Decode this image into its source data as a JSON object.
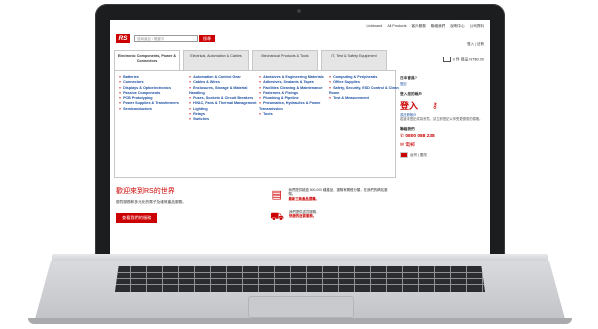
{
  "topbar": [
    "Linkbrand",
    "All Products",
    "客戶服務",
    "聯絡我們",
    "說明中心",
    "公司資料"
  ],
  "login_link": "登入 | 註冊",
  "logo": "RS",
  "search": {
    "placeholder": "搜尋產品 / 關鍵字",
    "button": "搜尋"
  },
  "cart": "0 件 商品 NT$0.00",
  "tabs": [
    {
      "label": "Electronic Components, Power & Connectors",
      "active": true
    },
    {
      "label": "Electrical, Automation & Cables",
      "active": false
    },
    {
      "label": "Mechanical Products & Tools",
      "active": false
    },
    {
      "label": "IT, Test & Safety Equipment",
      "active": false
    }
  ],
  "nav_columns": [
    [
      "Batteries",
      "Connectors",
      "Displays & Optoelectronics",
      "Passive Components",
      "PCB Prototyping",
      "Power Supplies & Transformers",
      "Semiconductors"
    ],
    [
      "Automation & Control Gear",
      "Cables & Wires",
      "Enclosures, Storage & Material Handling",
      "Fuses, Sockets & Circuit Breakers",
      "HVAC, Fans & Thermal Management",
      "Lighting",
      "Relays",
      "Switches"
    ],
    [
      "Abrasives & Engineering Materials",
      "Adhesives, Sealants & Tapes",
      "Facilities Cleaning & Maintenance",
      "Fasteners & Fixings",
      "Plumbing & Pipeline",
      "Pneumatics, Hydraulics & Power Transmission",
      "Tools"
    ],
    [
      "Computing & Peripherals",
      "Office Supplies",
      "Safety, Security, ESD Control & Clean Room",
      "Test & Measurement"
    ]
  ],
  "side": {
    "new_customer_title": "日本會員?",
    "new_customer_link": "登記",
    "login_title": "登入您的帳戶",
    "login_text": "登入",
    "login_sub": "或註冊帳戶",
    "info_text": "若還未登記成為會員，請立即登記以享受更優惠的價格。",
    "contact_title": "聯絡我們",
    "phone": "0800 088 238",
    "mail": "電郵",
    "region_label": "台灣 | 更改"
  },
  "welcome": {
    "title": "歡迎來到RS的世界",
    "text": "優質服務和多元化的電子及維修產品服務。",
    "button": "查看我們的服務"
  },
  "promos": [
    {
      "text": "我們提供超過 500,000 種產品，選購有關經分類，在我們的網站選購。",
      "strong": "最新三款產品選購。"
    },
    {
      "text": "我們提供送貨服務，",
      "strong": "快捷的送貨服務。"
    }
  ]
}
